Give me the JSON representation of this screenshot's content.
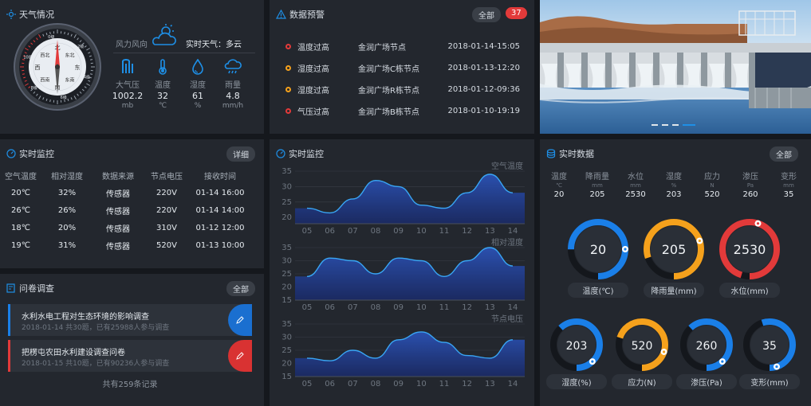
{
  "colors": {
    "bg": "#15181d",
    "panel": "#23272e",
    "accent": "#1e8fe6",
    "blue": "#1a7fe8",
    "orange": "#f5a11c",
    "red": "#e23a3a"
  },
  "weather": {
    "title": "天气情况",
    "wind_label": "风力风向",
    "realtime_label": "实时天气：多云",
    "compass": {
      "dirs": [
        "北",
        "东北",
        "东",
        "东南",
        "南",
        "西南",
        "西",
        "西北"
      ],
      "ring": [
        "0级",
        "2级",
        "4级",
        "6级",
        "8级",
        "10级"
      ]
    },
    "items": [
      {
        "icon": "pressure-icon",
        "label": "大气压",
        "value": "1002.2",
        "unit": "mb"
      },
      {
        "icon": "thermometer-icon",
        "label": "温度",
        "value": "32",
        "unit": "℃"
      },
      {
        "icon": "droplet-icon",
        "label": "湿度",
        "value": "61",
        "unit": "%"
      },
      {
        "icon": "rain-cloud-icon",
        "label": "雨量",
        "value": "4.8",
        "unit": "mm/h"
      }
    ]
  },
  "alerts": {
    "title": "数据预警",
    "all_label": "全部",
    "count": "37",
    "rows": [
      {
        "type": "温度过高",
        "location": "金润广场节点",
        "time": "2018-01-14-15:05",
        "color": "#e23a3a"
      },
      {
        "type": "湿度过高",
        "location": "金润广场C栋节点",
        "time": "2018-01-13-12:20",
        "color": "#f5a11c"
      },
      {
        "type": "湿度过高",
        "location": "金润广场R栋节点",
        "time": "2018-01-12-09:36",
        "color": "#f5a11c"
      },
      {
        "type": "气压过高",
        "location": "金润广场B栋节点",
        "time": "2018-01-10-19:19",
        "color": "#e23a3a"
      }
    ]
  },
  "monitor_table": {
    "title": "实时监控",
    "detail_label": "详细",
    "headers": [
      "空气温度",
      "相对湿度",
      "数据来源",
      "节点电压",
      "接收时间"
    ],
    "rows": [
      [
        "20℃",
        "32%",
        "传感器",
        "220V",
        "01-14 16:00"
      ],
      [
        "26℃",
        "26%",
        "传感器",
        "220V",
        "01-14 14:00"
      ],
      [
        "18℃",
        "20%",
        "传感器",
        "310V",
        "01-12 12:00"
      ],
      [
        "19℃",
        "31%",
        "传感器",
        "520V",
        "01-13 10:00"
      ]
    ]
  },
  "survey": {
    "title": "问卷调查",
    "all_label": "全部",
    "items": [
      {
        "title": "水利水电工程对生态环境的影响调查",
        "meta": "2018-01-14  共30题，已有25988人参与调查"
      },
      {
        "title": "把楞屯农田水利建设调查问卷",
        "meta": "2018-01-15  共10题，已有90236人参与调查"
      }
    ],
    "footer": "共有259条记录"
  },
  "monitor_chart": {
    "title": "实时监控"
  },
  "chart_data": [
    {
      "type": "area",
      "title": "空气温度",
      "x": [
        "05",
        "06",
        "07",
        "08",
        "09",
        "10",
        "11",
        "12",
        "13",
        "14"
      ],
      "yticks": [
        "35",
        "30",
        "25",
        "20"
      ],
      "series": [
        {
          "values": [
            23,
            21.5,
            26,
            32,
            30,
            24,
            23,
            28,
            34,
            28
          ]
        }
      ],
      "ylim": [
        18,
        35
      ]
    },
    {
      "type": "area",
      "title": "相对湿度",
      "x": [
        "05",
        "06",
        "07",
        "08",
        "09",
        "10",
        "11",
        "12",
        "13",
        "14"
      ],
      "yticks": [
        "35",
        "30",
        "25",
        "20",
        "15"
      ],
      "series": [
        {
          "values": [
            24,
            31,
            30,
            25,
            31,
            30,
            24,
            30,
            35,
            28
          ]
        }
      ],
      "ylim": [
        15,
        35
      ]
    },
    {
      "type": "area",
      "title": "节点电压",
      "x": [
        "05",
        "06",
        "07",
        "08",
        "09",
        "10",
        "11",
        "12",
        "13",
        "14"
      ],
      "yticks": [
        "35",
        "30",
        "25",
        "20",
        "15"
      ],
      "series": [
        {
          "values": [
            22,
            21,
            25,
            22,
            29,
            32,
            28,
            23,
            22,
            29
          ]
        }
      ],
      "ylim": [
        15,
        35
      ]
    }
  ],
  "realtime": {
    "title": "实时数据",
    "all_label": "全部",
    "cols": [
      {
        "label": "温度",
        "unit": "℃",
        "value": "20"
      },
      {
        "label": "降雨量",
        "unit": "mm",
        "value": "205"
      },
      {
        "label": "水位",
        "unit": "mm",
        "value": "2530"
      },
      {
        "label": "湿度",
        "unit": "%",
        "value": "203"
      },
      {
        "label": "应力",
        "unit": "N",
        "value": "520"
      },
      {
        "label": "渗压",
        "unit": "Pa",
        "value": "260"
      },
      {
        "label": "变形",
        "unit": "mm",
        "value": "35"
      }
    ],
    "gauges": [
      {
        "value": "20",
        "caption": "温度(℃)",
        "color": "#1a7fe8",
        "fraction": 0.75
      },
      {
        "value": "205",
        "caption": "降雨量(mm)",
        "color": "#f5a11c",
        "fraction": 0.8
      },
      {
        "value": "2530",
        "caption": "水位(mm)",
        "color": "#e23a3a",
        "fraction": 0.95
      },
      {
        "value": "203",
        "caption": "湿度(%)",
        "color": "#1a7fe8",
        "fraction": 0.62
      },
      {
        "value": "520",
        "caption": "应力(N)",
        "color": "#f5a11c",
        "fraction": 0.7
      },
      {
        "value": "260",
        "caption": "渗压(Pa)",
        "color": "#1a7fe8",
        "fraction": 0.62
      },
      {
        "value": "35",
        "caption": "变形(mm)",
        "color": "#1a7fe8",
        "fraction": 0.55
      }
    ]
  },
  "carousel": {
    "dots": 4,
    "active": 3
  }
}
